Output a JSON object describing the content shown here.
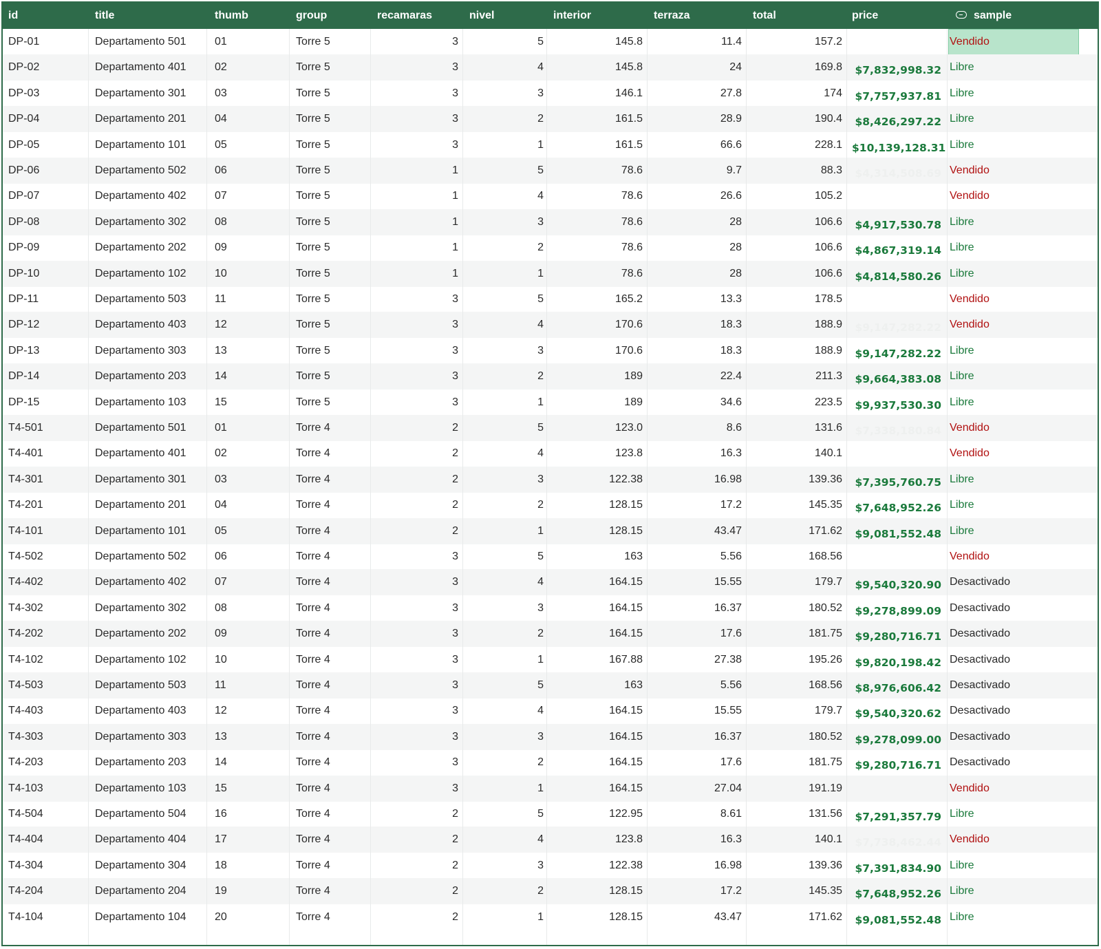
{
  "header": {
    "columns": [
      "id",
      "title",
      "thumb",
      "group",
      "recamaras",
      "nivel",
      "interior",
      "terraza",
      "total",
      "price",
      "sample"
    ]
  },
  "colors": {
    "header_bg": "#2e6b4a",
    "price_green": "#1b7a3c",
    "vendido_red": "#b01010",
    "selected_bg": "#b8e4cb"
  },
  "icons": {
    "sample_header_icon": "toggle-icon"
  },
  "rows": [
    {
      "id": "DP-01",
      "title": "Departamento 501",
      "thumb": "01",
      "group": "Torre 5",
      "recamaras": "3",
      "nivel": "5",
      "interior": "145.8",
      "terraza": "11.4",
      "total": "157.2",
      "price": "",
      "price_faint": false,
      "sample": "Vendido",
      "status": "vendido"
    },
    {
      "id": "DP-02",
      "title": "Departamento 401",
      "thumb": "02",
      "group": "Torre 5",
      "recamaras": "3",
      "nivel": "4",
      "interior": "145.8",
      "terraza": "24",
      "total": "169.8",
      "price": "$7,832,998.32",
      "price_faint": false,
      "sample": "Libre",
      "status": "libre"
    },
    {
      "id": "DP-03",
      "title": "Departamento 301",
      "thumb": "03",
      "group": "Torre 5",
      "recamaras": "3",
      "nivel": "3",
      "interior": "146.1",
      "terraza": "27.8",
      "total": "174",
      "price": "$7,757,937.81",
      "price_faint": false,
      "sample": "Libre",
      "status": "libre"
    },
    {
      "id": "DP-04",
      "title": "Departamento 201",
      "thumb": "04",
      "group": "Torre 5",
      "recamaras": "3",
      "nivel": "2",
      "interior": "161.5",
      "terraza": "28.9",
      "total": "190.4",
      "price": "$8,426,297.22",
      "price_faint": false,
      "sample": "Libre",
      "status": "libre"
    },
    {
      "id": "DP-05",
      "title": "Departamento 101",
      "thumb": "05",
      "group": "Torre 5",
      "recamaras": "3",
      "nivel": "1",
      "interior": "161.5",
      "terraza": "66.6",
      "total": "228.1",
      "price": "$10,139,128.31",
      "price_faint": false,
      "sample": "Libre",
      "status": "libre"
    },
    {
      "id": "DP-06",
      "title": "Departamento 502",
      "thumb": "06",
      "group": "Torre 5",
      "recamaras": "1",
      "nivel": "5",
      "interior": "78.6",
      "terraza": "9.7",
      "total": "88.3",
      "price": "$4,314,508.69",
      "price_faint": true,
      "sample": "Vendido",
      "status": "vendido"
    },
    {
      "id": "DP-07",
      "title": "Departamento 402",
      "thumb": "07",
      "group": "Torre 5",
      "recamaras": "1",
      "nivel": "4",
      "interior": "78.6",
      "terraza": "26.6",
      "total": "105.2",
      "price": "",
      "price_faint": false,
      "sample": "Vendido",
      "status": "vendido"
    },
    {
      "id": "DP-08",
      "title": "Departamento 302",
      "thumb": "08",
      "group": "Torre 5",
      "recamaras": "1",
      "nivel": "3",
      "interior": "78.6",
      "terraza": "28",
      "total": "106.6",
      "price": "$4,917,530.78",
      "price_faint": false,
      "sample": "Libre",
      "status": "libre"
    },
    {
      "id": "DP-09",
      "title": "Departamento 202",
      "thumb": "09",
      "group": "Torre 5",
      "recamaras": "1",
      "nivel": "2",
      "interior": "78.6",
      "terraza": "28",
      "total": "106.6",
      "price": "$4,867,319.14",
      "price_faint": false,
      "sample": "Libre",
      "status": "libre"
    },
    {
      "id": "DP-10",
      "title": "Departamento 102",
      "thumb": "10",
      "group": "Torre 5",
      "recamaras": "1",
      "nivel": "1",
      "interior": "78.6",
      "terraza": "28",
      "total": "106.6",
      "price": "$4,814,580.26",
      "price_faint": false,
      "sample": "Libre",
      "status": "libre"
    },
    {
      "id": "DP-11",
      "title": "Departamento 503",
      "thumb": "11",
      "group": "Torre 5",
      "recamaras": "3",
      "nivel": "5",
      "interior": "165.2",
      "terraza": "13.3",
      "total": "178.5",
      "price": "",
      "price_faint": false,
      "sample": "Vendido",
      "status": "vendido"
    },
    {
      "id": "DP-12",
      "title": "Departamento 403",
      "thumb": "12",
      "group": "Torre 5",
      "recamaras": "3",
      "nivel": "4",
      "interior": "170.6",
      "terraza": "18.3",
      "total": "188.9",
      "price": "$9,147,282.22",
      "price_faint": true,
      "sample": "Vendido",
      "status": "vendido"
    },
    {
      "id": "DP-13",
      "title": "Departamento 303",
      "thumb": "13",
      "group": "Torre 5",
      "recamaras": "3",
      "nivel": "3",
      "interior": "170.6",
      "terraza": "18.3",
      "total": "188.9",
      "price": "$9,147,282.22",
      "price_faint": false,
      "sample": "Libre",
      "status": "libre"
    },
    {
      "id": "DP-14",
      "title": "Departamento 203",
      "thumb": "14",
      "group": "Torre 5",
      "recamaras": "3",
      "nivel": "2",
      "interior": "189",
      "terraza": "22.4",
      "total": "211.3",
      "price": "$9,664,383.08",
      "price_faint": false,
      "sample": "Libre",
      "status": "libre"
    },
    {
      "id": "DP-15",
      "title": "Departamento 103",
      "thumb": "15",
      "group": "Torre 5",
      "recamaras": "3",
      "nivel": "1",
      "interior": "189",
      "terraza": "34.6",
      "total": "223.5",
      "price": "$9,937,530.30",
      "price_faint": false,
      "sample": "Libre",
      "status": "libre"
    },
    {
      "id": "T4-501",
      "title": "Departamento 501",
      "thumb": "01",
      "group": "Torre 4",
      "recamaras": "2",
      "nivel": "5",
      "interior": "123.0",
      "terraza": "8.6",
      "total": "131.6",
      "price": "$7,338,180.84",
      "price_faint": true,
      "sample": "Vendido",
      "status": "vendido"
    },
    {
      "id": "T4-401",
      "title": "Departamento 401",
      "thumb": "02",
      "group": "Torre 4",
      "recamaras": "2",
      "nivel": "4",
      "interior": "123.8",
      "terraza": "16.3",
      "total": "140.1",
      "price": "",
      "price_faint": false,
      "sample": "Vendido",
      "status": "vendido"
    },
    {
      "id": "T4-301",
      "title": "Departamento 301",
      "thumb": "03",
      "group": "Torre 4",
      "recamaras": "2",
      "nivel": "3",
      "interior": "122.38",
      "terraza": "16.98",
      "total": "139.36",
      "price": "$7,395,760.75",
      "price_faint": false,
      "sample": "Libre",
      "status": "libre"
    },
    {
      "id": "T4-201",
      "title": "Departamento 201",
      "thumb": "04",
      "group": "Torre 4",
      "recamaras": "2",
      "nivel": "2",
      "interior": "128.15",
      "terraza": "17.2",
      "total": "145.35",
      "price": "$7,648,952.26",
      "price_faint": false,
      "sample": "Libre",
      "status": "libre"
    },
    {
      "id": "T4-101",
      "title": "Departamento 101",
      "thumb": "05",
      "group": "Torre 4",
      "recamaras": "2",
      "nivel": "1",
      "interior": "128.15",
      "terraza": "43.47",
      "total": "171.62",
      "price": "$9,081,552.48",
      "price_faint": false,
      "sample": "Libre",
      "status": "libre"
    },
    {
      "id": "T4-502",
      "title": "Departamento 502",
      "thumb": "06",
      "group": "Torre 4",
      "recamaras": "3",
      "nivel": "5",
      "interior": "163",
      "terraza": "5.56",
      "total": "168.56",
      "price": "",
      "price_faint": false,
      "sample": "Vendido",
      "status": "vendido"
    },
    {
      "id": "T4-402",
      "title": "Departamento 402",
      "thumb": "07",
      "group": "Torre 4",
      "recamaras": "3",
      "nivel": "4",
      "interior": "164.15",
      "terraza": "15.55",
      "total": "179.7",
      "price": "$9,540,320.90",
      "price_faint": false,
      "sample": "Desactivado",
      "status": "desactivado"
    },
    {
      "id": "T4-302",
      "title": "Departamento 302",
      "thumb": "08",
      "group": "Torre 4",
      "recamaras": "3",
      "nivel": "3",
      "interior": "164.15",
      "terraza": "16.37",
      "total": "180.52",
      "price": "$9,278,899.09",
      "price_faint": false,
      "sample": "Desactivado",
      "status": "desactivado"
    },
    {
      "id": "T4-202",
      "title": "Departamento 202",
      "thumb": "09",
      "group": "Torre 4",
      "recamaras": "3",
      "nivel": "2",
      "interior": "164.15",
      "terraza": "17.6",
      "total": "181.75",
      "price": "$9,280,716.71",
      "price_faint": false,
      "sample": "Desactivado",
      "status": "desactivado"
    },
    {
      "id": "T4-102",
      "title": "Departamento 102",
      "thumb": "10",
      "group": "Torre 4",
      "recamaras": "3",
      "nivel": "1",
      "interior": "167.88",
      "terraza": "27.38",
      "total": "195.26",
      "price": "$9,820,198.42",
      "price_faint": false,
      "sample": "Desactivado",
      "status": "desactivado"
    },
    {
      "id": "T4-503",
      "title": "Departamento 503",
      "thumb": "11",
      "group": "Torre 4",
      "recamaras": "3",
      "nivel": "5",
      "interior": "163",
      "terraza": "5.56",
      "total": "168.56",
      "price": "$8,976,606.42",
      "price_faint": false,
      "sample": "Desactivado",
      "status": "desactivado"
    },
    {
      "id": "T4-403",
      "title": "Departamento 403",
      "thumb": "12",
      "group": "Torre 4",
      "recamaras": "3",
      "nivel": "4",
      "interior": "164.15",
      "terraza": "15.55",
      "total": "179.7",
      "price": "$9,540,320.62",
      "price_faint": false,
      "sample": "Desactivado",
      "status": "desactivado"
    },
    {
      "id": "T4-303",
      "title": "Departamento 303",
      "thumb": "13",
      "group": "Torre 4",
      "recamaras": "3",
      "nivel": "3",
      "interior": "164.15",
      "terraza": "16.37",
      "total": "180.52",
      "price": "$9,278,099.00",
      "price_faint": false,
      "sample": "Desactivado",
      "status": "desactivado"
    },
    {
      "id": "T4-203",
      "title": "Departamento 203",
      "thumb": "14",
      "group": "Torre 4",
      "recamaras": "3",
      "nivel": "2",
      "interior": "164.15",
      "terraza": "17.6",
      "total": "181.75",
      "price": "$9,280,716.71",
      "price_faint": false,
      "sample": "Desactivado",
      "status": "desactivado"
    },
    {
      "id": "T4-103",
      "title": "Departamento 103",
      "thumb": "15",
      "group": "Torre 4",
      "recamaras": "3",
      "nivel": "1",
      "interior": "164.15",
      "terraza": "27.04",
      "total": "191.19",
      "price": "",
      "price_faint": false,
      "sample": "Vendido",
      "status": "vendido"
    },
    {
      "id": "T4-504",
      "title": "Departamento 504",
      "thumb": "16",
      "group": "Torre 4",
      "recamaras": "2",
      "nivel": "5",
      "interior": "122.95",
      "terraza": "8.61",
      "total": "131.56",
      "price": "$7,291,357.79",
      "price_faint": false,
      "sample": "Libre",
      "status": "libre"
    },
    {
      "id": "T4-404",
      "title": "Departamento 404",
      "thumb": "17",
      "group": "Torre 4",
      "recamaras": "2",
      "nivel": "4",
      "interior": "123.8",
      "terraza": "16.3",
      "total": "140.1",
      "price": "$7,738,462.44",
      "price_faint": true,
      "sample": "Vendido",
      "status": "vendido"
    },
    {
      "id": "T4-304",
      "title": "Departamento 304",
      "thumb": "18",
      "group": "Torre 4",
      "recamaras": "2",
      "nivel": "3",
      "interior": "122.38",
      "terraza": "16.98",
      "total": "139.36",
      "price": "$7,391,834.90",
      "price_faint": false,
      "sample": "Libre",
      "status": "libre"
    },
    {
      "id": "T4-204",
      "title": "Departamento 204",
      "thumb": "19",
      "group": "Torre 4",
      "recamaras": "2",
      "nivel": "2",
      "interior": "128.15",
      "terraza": "17.2",
      "total": "145.35",
      "price": "$7,648,952.26",
      "price_faint": false,
      "sample": "Libre",
      "status": "libre"
    },
    {
      "id": "T4-104",
      "title": "Departamento 104",
      "thumb": "20",
      "group": "Torre 4",
      "recamaras": "2",
      "nivel": "1",
      "interior": "128.15",
      "terraza": "43.47",
      "total": "171.62",
      "price": "$9,081,552.48",
      "price_faint": false,
      "sample": "Libre",
      "status": "libre"
    }
  ]
}
